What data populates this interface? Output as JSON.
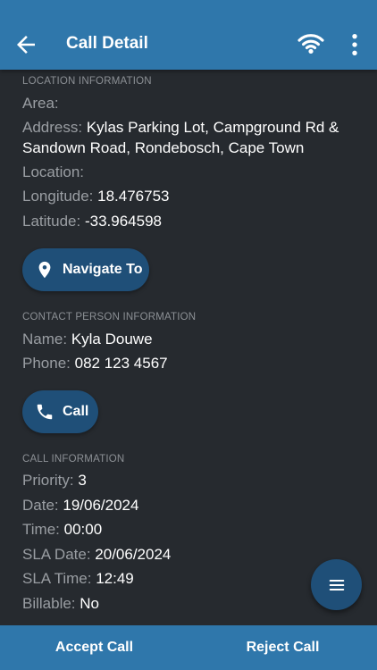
{
  "header": {
    "title": "Call Detail"
  },
  "location": {
    "section_title": "LOCATION INFORMATION",
    "area_label": "Area:",
    "area_value": "",
    "address_label": "Address:",
    "address_value": "Kylas Parking Lot, Campground Rd & Sandown Road, Rondebosch, Cape Town",
    "location_label": "Location:",
    "location_value": "",
    "longitude_label": "Longitude:",
    "longitude_value": "18.476753",
    "latitude_label": "Latitude:",
    "latitude_value": "-33.964598",
    "navigate_label": "Navigate To"
  },
  "contact": {
    "section_title": "CONTACT PERSON INFORMATION",
    "name_label": "Name:",
    "name_value": "Kyla Douwe",
    "phone_label": "Phone:",
    "phone_value": "082 123 4567",
    "call_label": "Call"
  },
  "call_info": {
    "section_title": "CALL INFORMATION",
    "priority_label": "Priority:",
    "priority_value": "3",
    "date_label": "Date:",
    "date_value": "19/06/2024",
    "time_label": "Time:",
    "time_value": "00:00",
    "sla_date_label": "SLA Date:",
    "sla_date_value": "20/06/2024",
    "sla_time_label": "SLA Time:",
    "sla_time_value": "12:49",
    "billable_label": "Billable:",
    "billable_value": "No"
  },
  "footer": {
    "accept_label": "Accept Call",
    "reject_label": "Reject Call"
  },
  "colors": {
    "primary": "#2f77ab",
    "button": "#1f4f78",
    "background": "#262a2f"
  },
  "icons": {
    "back": "arrow-left-icon",
    "wifi": "wifi-icon",
    "more": "more-vertical-icon",
    "navigate": "map-pin-icon",
    "call": "phone-icon",
    "fab": "menu-icon"
  }
}
